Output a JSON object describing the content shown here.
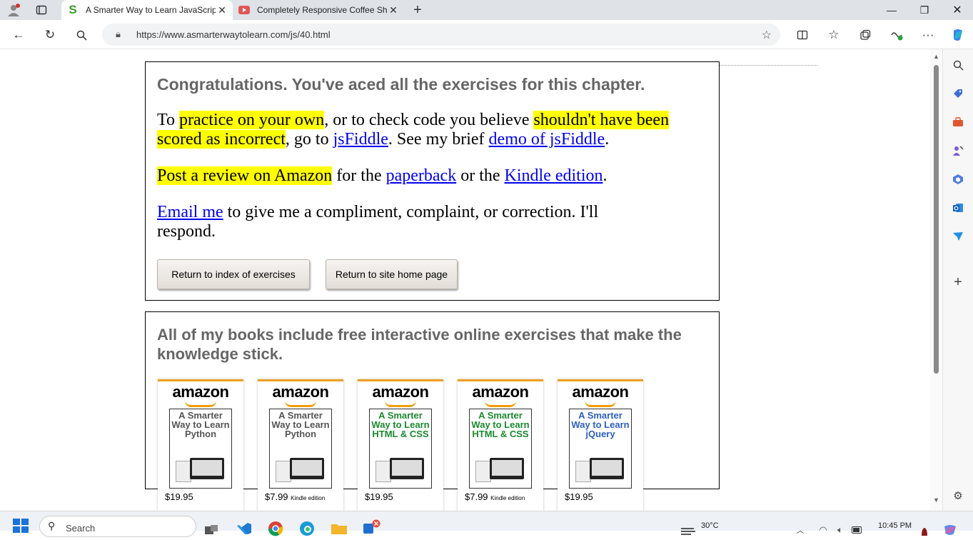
{
  "browser": {
    "tabs": [
      {
        "favicon": "S",
        "title": "A Smarter Way to Learn JavaScrip",
        "active": true
      },
      {
        "favicon": "youtube-icon",
        "title": "Completely Responsive Coffee Sh",
        "active": false
      }
    ],
    "url": "https://www.asmarterwaytolearn.com/js/40.html"
  },
  "page": {
    "congrats": "Congratulations. You've aced all the exercises for this chapter.",
    "p1": {
      "t1": "To ",
      "h1": "practice on your own",
      "t2": ", or to check code you believe ",
      "h2": "shouldn't have been scored as incorrect",
      "t3": ", go to ",
      "l1": "jsFiddle",
      "t4": ". See my brief ",
      "l2": "demo of jsFiddle",
      "t5": "."
    },
    "p2": {
      "h1": "Post a review on Amazon",
      "t1": " for the ",
      "l1": "paperback",
      "t2": " or the ",
      "l2": "Kindle edition",
      "t3": "."
    },
    "p3": {
      "l1": "Email me",
      "t1": " to give me a compliment, complaint, or correction. I'll respond."
    },
    "buttons": {
      "index": "Return to index of exercises",
      "home": "Return to site home page"
    },
    "books_heading": "All of my books include free interactive online exercises that make the knowledge stick.",
    "books": [
      {
        "store": "amazon",
        "title": "A Smarter Way to Learn Python",
        "price": "$19.95",
        "edition": "",
        "color": "#555555"
      },
      {
        "store": "amazon",
        "title": "A Smarter Way to Learn Python",
        "price": "$7.99",
        "edition": "Kindle edition",
        "color": "#555555"
      },
      {
        "store": "amazon",
        "title": "A Smarter Way to Learn HTML & CSS",
        "price": "$19.95",
        "edition": "",
        "color": "#1a8a2e"
      },
      {
        "store": "amazon",
        "title": "A Smarter Way to Learn HTML & CSS",
        "price": "$7.99",
        "edition": "Kindle edition",
        "color": "#1a8a2e"
      },
      {
        "store": "amazon",
        "title": "A Smarter Way to Learn jQuery",
        "price": "$19.95",
        "edition": "",
        "color": "#2b5fc4"
      }
    ]
  },
  "taskbar": {
    "search_placeholder": "Search",
    "weather": "30°C",
    "time": "10:45 PM"
  }
}
